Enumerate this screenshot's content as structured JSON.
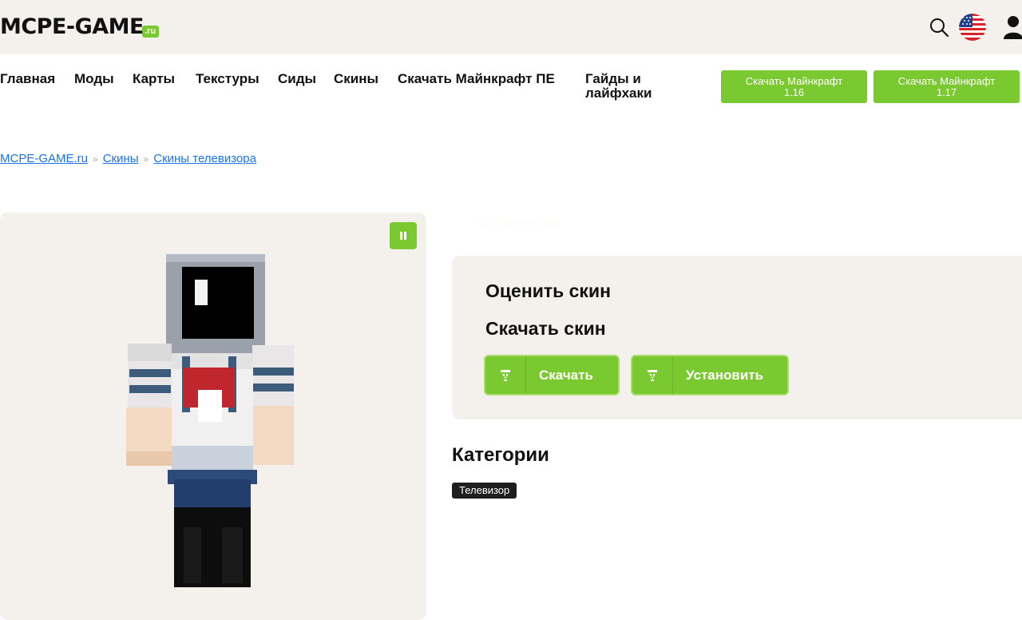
{
  "header": {
    "logo_text": "MCPE-GAME",
    "logo_suffix": ".ru",
    "icons": [
      "search-icon",
      "us-flag-icon",
      "user-icon"
    ]
  },
  "nav": {
    "items": [
      "Главная",
      "Моды",
      "Карты",
      "Текстуры",
      "Сиды",
      "Скины",
      "Скачать Майнкрафт ПЕ",
      "Гайды и лайфхаки"
    ],
    "buttons": [
      "Скачать Майнкрафт 1.16",
      "Скачать Майнкрафт 1.17"
    ]
  },
  "breadcrumb": {
    "items": [
      "MCPE-GAME.ru",
      "Скины",
      "Скины телевизора"
    ],
    "separator": "»"
  },
  "views_text": "154 просмотров",
  "rating": {
    "rate_title": "Оценить скин",
    "download_title": "Скачать скин",
    "download_button": "Скачать",
    "install_button": "Установить"
  },
  "categories": {
    "title": "Категории",
    "tags": [
      "Телевизор"
    ]
  },
  "colors": {
    "accent": "#7bc930",
    "header_bg": "#f4f1ec",
    "link": "#1a73e8"
  }
}
